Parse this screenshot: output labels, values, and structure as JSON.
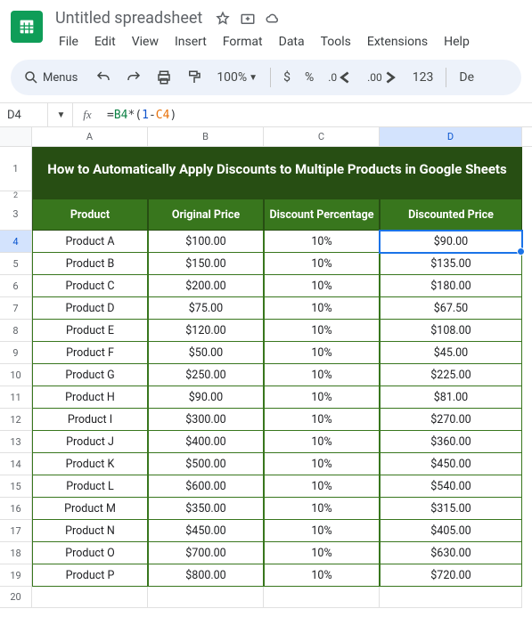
{
  "doc": {
    "title": "Untitled spreadsheet"
  },
  "menus": {
    "file": "File",
    "edit": "Edit",
    "view": "View",
    "insert": "Insert",
    "format": "Format",
    "data": "Data",
    "tools": "Tools",
    "extensions": "Extensions",
    "help": "Help"
  },
  "toolbar": {
    "search_label": "Menus",
    "zoom": "100%",
    "currency": "$",
    "percent": "%",
    "dec_dec": ".0",
    "dec_inc": ".00",
    "num_format": "123",
    "font_initial": "De"
  },
  "formula": {
    "name_box": "D4",
    "fx": "fx",
    "eq": "=",
    "ref1": "B4",
    "op": "*",
    "par_o": "(",
    "num": "1",
    "minus": "-",
    "ref2": "C4",
    "par_c": ")"
  },
  "columns": [
    "A",
    "B",
    "C",
    "D"
  ],
  "selected_col_index": 3,
  "title_row": {
    "num": "1",
    "text": "How to Automatically Apply Discounts to Multiple Products in Google Sheets"
  },
  "sub_row": {
    "num": "2"
  },
  "headers": {
    "num": "3",
    "product": "Product",
    "original": "Original Price",
    "discount_pct": "Discount Percentage",
    "discounted": "Discounted Price"
  },
  "active_row_index": 0,
  "rows": [
    {
      "num": "4",
      "product": "Product A",
      "original": "$100.00",
      "pct": "10%",
      "discounted": "$90.00"
    },
    {
      "num": "5",
      "product": "Product B",
      "original": "$150.00",
      "pct": "10%",
      "discounted": "$135.00"
    },
    {
      "num": "6",
      "product": "Product C",
      "original": "$200.00",
      "pct": "10%",
      "discounted": "$180.00"
    },
    {
      "num": "7",
      "product": "Product D",
      "original": "$75.00",
      "pct": "10%",
      "discounted": "$67.50"
    },
    {
      "num": "8",
      "product": "Product E",
      "original": "$120.00",
      "pct": "10%",
      "discounted": "$108.00"
    },
    {
      "num": "9",
      "product": "Product F",
      "original": "$50.00",
      "pct": "10%",
      "discounted": "$45.00"
    },
    {
      "num": "10",
      "product": "Product G",
      "original": "$250.00",
      "pct": "10%",
      "discounted": "$225.00"
    },
    {
      "num": "11",
      "product": "Product H",
      "original": "$90.00",
      "pct": "10%",
      "discounted": "$81.00"
    },
    {
      "num": "12",
      "product": "Product I",
      "original": "$300.00",
      "pct": "10%",
      "discounted": "$270.00"
    },
    {
      "num": "13",
      "product": "Product J",
      "original": "$400.00",
      "pct": "10%",
      "discounted": "$360.00"
    },
    {
      "num": "14",
      "product": "Product K",
      "original": "$500.00",
      "pct": "10%",
      "discounted": "$450.00"
    },
    {
      "num": "15",
      "product": "Product L",
      "original": "$600.00",
      "pct": "10%",
      "discounted": "$540.00"
    },
    {
      "num": "16",
      "product": "Product M",
      "original": "$350.00",
      "pct": "10%",
      "discounted": "$315.00"
    },
    {
      "num": "17",
      "product": "Product N",
      "original": "$450.00",
      "pct": "10%",
      "discounted": "$405.00"
    },
    {
      "num": "18",
      "product": "Product O",
      "original": "$700.00",
      "pct": "10%",
      "discounted": "$630.00"
    },
    {
      "num": "19",
      "product": "Product P",
      "original": "$800.00",
      "pct": "10%",
      "discounted": "$720.00"
    }
  ],
  "empty_row": {
    "num": "20"
  },
  "chart_data": {
    "type": "table",
    "title": "How to Automatically Apply Discounts to Multiple Products in Google Sheets",
    "columns": [
      "Product",
      "Original Price",
      "Discount Percentage",
      "Discounted Price"
    ],
    "rows": [
      [
        "Product A",
        100.0,
        0.1,
        90.0
      ],
      [
        "Product B",
        150.0,
        0.1,
        135.0
      ],
      [
        "Product C",
        200.0,
        0.1,
        180.0
      ],
      [
        "Product D",
        75.0,
        0.1,
        67.5
      ],
      [
        "Product E",
        120.0,
        0.1,
        108.0
      ],
      [
        "Product F",
        50.0,
        0.1,
        45.0
      ],
      [
        "Product G",
        250.0,
        0.1,
        225.0
      ],
      [
        "Product H",
        90.0,
        0.1,
        81.0
      ],
      [
        "Product I",
        300.0,
        0.1,
        270.0
      ],
      [
        "Product J",
        400.0,
        0.1,
        360.0
      ],
      [
        "Product K",
        500.0,
        0.1,
        450.0
      ],
      [
        "Product L",
        600.0,
        0.1,
        540.0
      ],
      [
        "Product M",
        350.0,
        0.1,
        315.0
      ],
      [
        "Product N",
        450.0,
        0.1,
        405.0
      ],
      [
        "Product O",
        700.0,
        0.1,
        630.0
      ],
      [
        "Product P",
        800.0,
        0.1,
        720.0
      ]
    ]
  }
}
